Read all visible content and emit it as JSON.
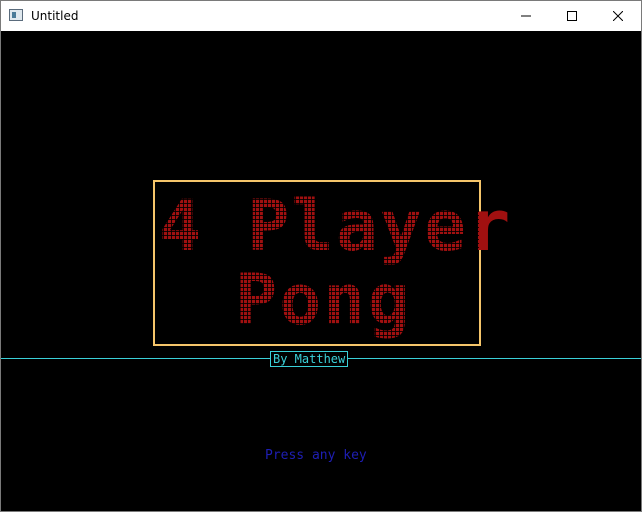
{
  "window": {
    "title": "Untitled",
    "icons": {
      "app": "app-window-icon",
      "minimize": "minimize-icon",
      "maximize": "maximize-icon",
      "close": "close-icon"
    }
  },
  "game": {
    "title_line1": "4 Player",
    "title_line2": "Pong",
    "byline": "By Matthew",
    "prompt": "Press any key"
  },
  "colors": {
    "background": "#000000",
    "title_box": "#f5c56a",
    "logo": "#a01010",
    "byline": "#3ad0d8",
    "prompt": "#1e1eb4"
  }
}
